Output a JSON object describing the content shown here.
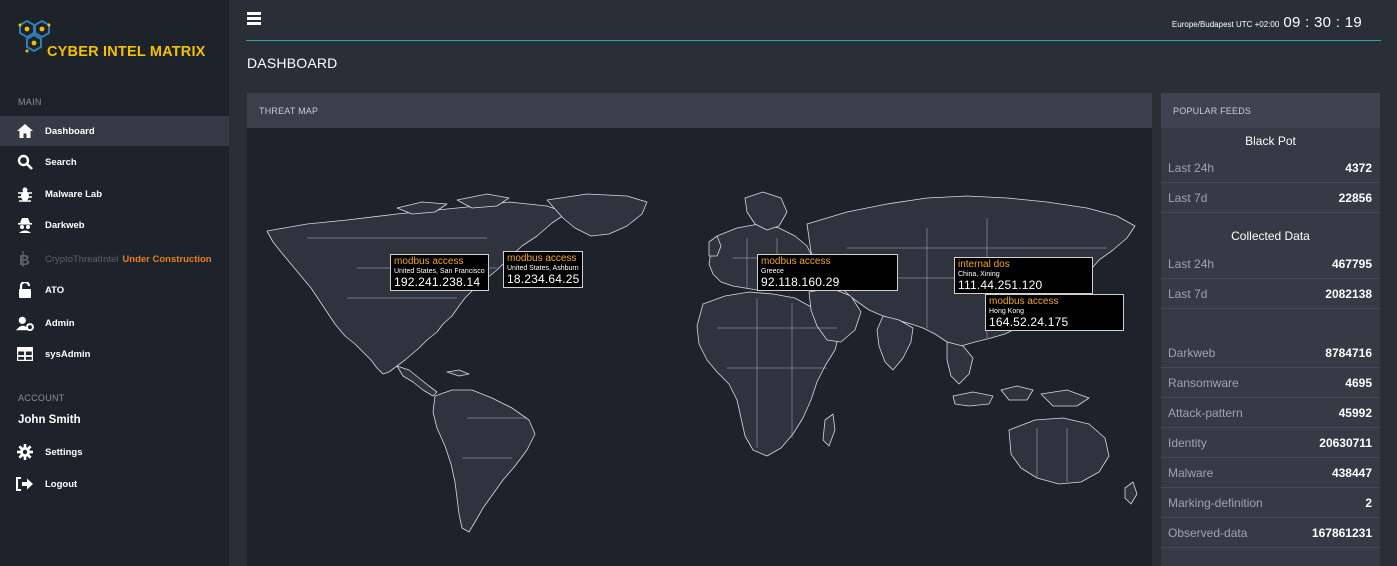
{
  "brand": {
    "name": "CYBER INTEL MATRIX"
  },
  "sidebar": {
    "main_label": "MAIN",
    "items": [
      {
        "label": "Dashboard",
        "icon": "home-icon"
      },
      {
        "label": "Search",
        "icon": "search-icon"
      },
      {
        "label": "Malware Lab",
        "icon": "bug-icon"
      },
      {
        "label": "Darkweb",
        "icon": "spy-icon"
      },
      {
        "label": "CryptoThreatIntel",
        "icon": "bitcoin-icon",
        "badge": "Under Construction"
      },
      {
        "label": "ATO",
        "icon": "unlock-icon"
      },
      {
        "label": "Admin",
        "icon": "users-cog-icon"
      },
      {
        "label": "sysAdmin",
        "icon": "grid-icon"
      }
    ],
    "account_label": "ACCOUNT",
    "user": "John Smith",
    "account_items": [
      {
        "label": "Settings",
        "icon": "gear-icon"
      },
      {
        "label": "Logout",
        "icon": "logout-icon"
      }
    ]
  },
  "topbar": {
    "timezone": "Europe/Budapest UTC +02:00",
    "time": "09 : 30 : 19"
  },
  "page": {
    "title": "DASHBOARD"
  },
  "threat_map": {
    "title": "THREAT MAP",
    "popups": [
      {
        "type": "modbus access",
        "location": "United States, San Francisco",
        "ip": "192.241.238.14"
      },
      {
        "type": "modbus access",
        "location": "United States, Ashburn",
        "ip": "18.234.64.25"
      },
      {
        "type": "modbus access",
        "location": "Greece",
        "ip": "92.118.160.29"
      },
      {
        "type": "internal dos",
        "location": "China, Xining",
        "ip": "111.44.251.120"
      },
      {
        "type": "modbus access",
        "location": "Hong Kong",
        "ip": "164.52.24.175"
      }
    ]
  },
  "feeds": {
    "title": "POPULAR FEEDS",
    "black_pot": {
      "title": "Black Pot",
      "rows": [
        {
          "k": "Last 24h",
          "v": "4372"
        },
        {
          "k": "Last 7d",
          "v": "22856"
        }
      ]
    },
    "collected": {
      "title": "Collected Data",
      "rows": [
        {
          "k": "Last 24h",
          "v": "467795"
        },
        {
          "k": "Last 7d",
          "v": "2082138"
        }
      ]
    },
    "totals": [
      {
        "k": "Darkweb",
        "v": "8784716"
      },
      {
        "k": "Ransomware",
        "v": "4695"
      },
      {
        "k": "Attack-pattern",
        "v": "45992"
      },
      {
        "k": "Identity",
        "v": "20630711"
      },
      {
        "k": "Malware",
        "v": "438447"
      },
      {
        "k": "Marking-definition",
        "v": "2"
      },
      {
        "k": "Observed-data",
        "v": "167861231"
      }
    ]
  }
}
